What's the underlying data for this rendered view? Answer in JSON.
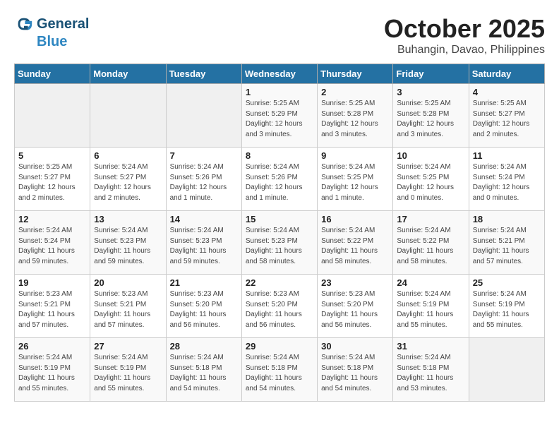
{
  "header": {
    "logo_general": "General",
    "logo_blue": "Blue",
    "month": "October 2025",
    "location": "Buhangin, Davao, Philippines"
  },
  "weekdays": [
    "Sunday",
    "Monday",
    "Tuesday",
    "Wednesday",
    "Thursday",
    "Friday",
    "Saturday"
  ],
  "weeks": [
    [
      {
        "day": "",
        "sunrise": "",
        "sunset": "",
        "daylight": ""
      },
      {
        "day": "",
        "sunrise": "",
        "sunset": "",
        "daylight": ""
      },
      {
        "day": "",
        "sunrise": "",
        "sunset": "",
        "daylight": ""
      },
      {
        "day": "1",
        "sunrise": "Sunrise: 5:25 AM",
        "sunset": "Sunset: 5:29 PM",
        "daylight": "Daylight: 12 hours and 3 minutes."
      },
      {
        "day": "2",
        "sunrise": "Sunrise: 5:25 AM",
        "sunset": "Sunset: 5:28 PM",
        "daylight": "Daylight: 12 hours and 3 minutes."
      },
      {
        "day": "3",
        "sunrise": "Sunrise: 5:25 AM",
        "sunset": "Sunset: 5:28 PM",
        "daylight": "Daylight: 12 hours and 3 minutes."
      },
      {
        "day": "4",
        "sunrise": "Sunrise: 5:25 AM",
        "sunset": "Sunset: 5:27 PM",
        "daylight": "Daylight: 12 hours and 2 minutes."
      }
    ],
    [
      {
        "day": "5",
        "sunrise": "Sunrise: 5:25 AM",
        "sunset": "Sunset: 5:27 PM",
        "daylight": "Daylight: 12 hours and 2 minutes."
      },
      {
        "day": "6",
        "sunrise": "Sunrise: 5:24 AM",
        "sunset": "Sunset: 5:27 PM",
        "daylight": "Daylight: 12 hours and 2 minutes."
      },
      {
        "day": "7",
        "sunrise": "Sunrise: 5:24 AM",
        "sunset": "Sunset: 5:26 PM",
        "daylight": "Daylight: 12 hours and 1 minute."
      },
      {
        "day": "8",
        "sunrise": "Sunrise: 5:24 AM",
        "sunset": "Sunset: 5:26 PM",
        "daylight": "Daylight: 12 hours and 1 minute."
      },
      {
        "day": "9",
        "sunrise": "Sunrise: 5:24 AM",
        "sunset": "Sunset: 5:25 PM",
        "daylight": "Daylight: 12 hours and 1 minute."
      },
      {
        "day": "10",
        "sunrise": "Sunrise: 5:24 AM",
        "sunset": "Sunset: 5:25 PM",
        "daylight": "Daylight: 12 hours and 0 minutes."
      },
      {
        "day": "11",
        "sunrise": "Sunrise: 5:24 AM",
        "sunset": "Sunset: 5:24 PM",
        "daylight": "Daylight: 12 hours and 0 minutes."
      }
    ],
    [
      {
        "day": "12",
        "sunrise": "Sunrise: 5:24 AM",
        "sunset": "Sunset: 5:24 PM",
        "daylight": "Daylight: 11 hours and 59 minutes."
      },
      {
        "day": "13",
        "sunrise": "Sunrise: 5:24 AM",
        "sunset": "Sunset: 5:23 PM",
        "daylight": "Daylight: 11 hours and 59 minutes."
      },
      {
        "day": "14",
        "sunrise": "Sunrise: 5:24 AM",
        "sunset": "Sunset: 5:23 PM",
        "daylight": "Daylight: 11 hours and 59 minutes."
      },
      {
        "day": "15",
        "sunrise": "Sunrise: 5:24 AM",
        "sunset": "Sunset: 5:23 PM",
        "daylight": "Daylight: 11 hours and 58 minutes."
      },
      {
        "day": "16",
        "sunrise": "Sunrise: 5:24 AM",
        "sunset": "Sunset: 5:22 PM",
        "daylight": "Daylight: 11 hours and 58 minutes."
      },
      {
        "day": "17",
        "sunrise": "Sunrise: 5:24 AM",
        "sunset": "Sunset: 5:22 PM",
        "daylight": "Daylight: 11 hours and 58 minutes."
      },
      {
        "day": "18",
        "sunrise": "Sunrise: 5:24 AM",
        "sunset": "Sunset: 5:21 PM",
        "daylight": "Daylight: 11 hours and 57 minutes."
      }
    ],
    [
      {
        "day": "19",
        "sunrise": "Sunrise: 5:23 AM",
        "sunset": "Sunset: 5:21 PM",
        "daylight": "Daylight: 11 hours and 57 minutes."
      },
      {
        "day": "20",
        "sunrise": "Sunrise: 5:23 AM",
        "sunset": "Sunset: 5:21 PM",
        "daylight": "Daylight: 11 hours and 57 minutes."
      },
      {
        "day": "21",
        "sunrise": "Sunrise: 5:23 AM",
        "sunset": "Sunset: 5:20 PM",
        "daylight": "Daylight: 11 hours and 56 minutes."
      },
      {
        "day": "22",
        "sunrise": "Sunrise: 5:23 AM",
        "sunset": "Sunset: 5:20 PM",
        "daylight": "Daylight: 11 hours and 56 minutes."
      },
      {
        "day": "23",
        "sunrise": "Sunrise: 5:23 AM",
        "sunset": "Sunset: 5:20 PM",
        "daylight": "Daylight: 11 hours and 56 minutes."
      },
      {
        "day": "24",
        "sunrise": "Sunrise: 5:24 AM",
        "sunset": "Sunset: 5:19 PM",
        "daylight": "Daylight: 11 hours and 55 minutes."
      },
      {
        "day": "25",
        "sunrise": "Sunrise: 5:24 AM",
        "sunset": "Sunset: 5:19 PM",
        "daylight": "Daylight: 11 hours and 55 minutes."
      }
    ],
    [
      {
        "day": "26",
        "sunrise": "Sunrise: 5:24 AM",
        "sunset": "Sunset: 5:19 PM",
        "daylight": "Daylight: 11 hours and 55 minutes."
      },
      {
        "day": "27",
        "sunrise": "Sunrise: 5:24 AM",
        "sunset": "Sunset: 5:19 PM",
        "daylight": "Daylight: 11 hours and 55 minutes."
      },
      {
        "day": "28",
        "sunrise": "Sunrise: 5:24 AM",
        "sunset": "Sunset: 5:18 PM",
        "daylight": "Daylight: 11 hours and 54 minutes."
      },
      {
        "day": "29",
        "sunrise": "Sunrise: 5:24 AM",
        "sunset": "Sunset: 5:18 PM",
        "daylight": "Daylight: 11 hours and 54 minutes."
      },
      {
        "day": "30",
        "sunrise": "Sunrise: 5:24 AM",
        "sunset": "Sunset: 5:18 PM",
        "daylight": "Daylight: 11 hours and 54 minutes."
      },
      {
        "day": "31",
        "sunrise": "Sunrise: 5:24 AM",
        "sunset": "Sunset: 5:18 PM",
        "daylight": "Daylight: 11 hours and 53 minutes."
      },
      {
        "day": "",
        "sunrise": "",
        "sunset": "",
        "daylight": ""
      }
    ]
  ]
}
